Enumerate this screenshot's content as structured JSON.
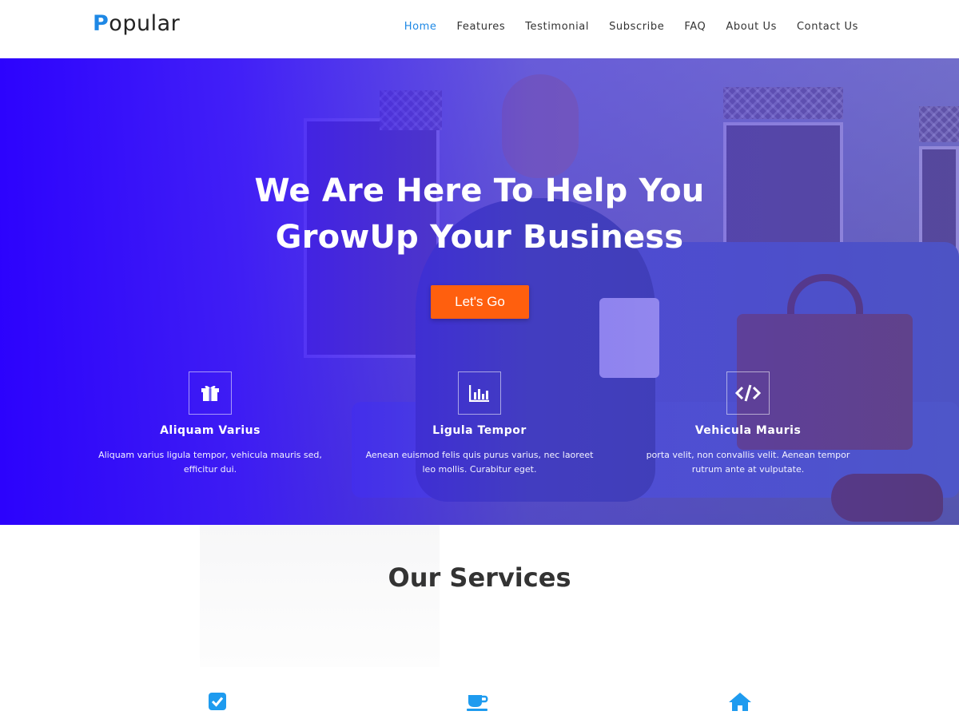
{
  "brand": {
    "logo_first": "P",
    "logo_rest": "opular",
    "accent": "#1e88e5"
  },
  "nav": [
    {
      "label": "Home",
      "active": true
    },
    {
      "label": "Features"
    },
    {
      "label": "Testimonial"
    },
    {
      "label": "Subscribe"
    },
    {
      "label": "FAQ"
    },
    {
      "label": "About Us"
    },
    {
      "label": "Contact Us"
    }
  ],
  "hero": {
    "title_line1": "We Are Here To Help You",
    "title_line2": "GrowUp Your Business",
    "cta_label": "Let's Go",
    "cta_color": "#ff5f0e",
    "overlay_color": "#2b00ff"
  },
  "features": [
    {
      "icon": "gift-icon",
      "title": "Aliquam Varius",
      "desc_line1": "Aliquam varius ligula tempor, vehicula mauris sed,",
      "desc_line2": "efficitur dui."
    },
    {
      "icon": "bar-chart-icon",
      "title": "Ligula Tempor",
      "desc_line1": "Aenean euismod felis quis purus varius, nec laoreet",
      "desc_line2": "leo mollis. Curabitur eget."
    },
    {
      "icon": "code-icon",
      "title": "Vehicula Mauris",
      "desc_line1": "porta velit, non convallis velit. Aenean tempor",
      "desc_line2": "rutrum ante at vulputate."
    }
  ],
  "services": {
    "title": "Our Services",
    "icons": [
      "check-square-icon",
      "coffee-cup-icon",
      "home-icon"
    ],
    "icon_color": "#1e9bef"
  }
}
